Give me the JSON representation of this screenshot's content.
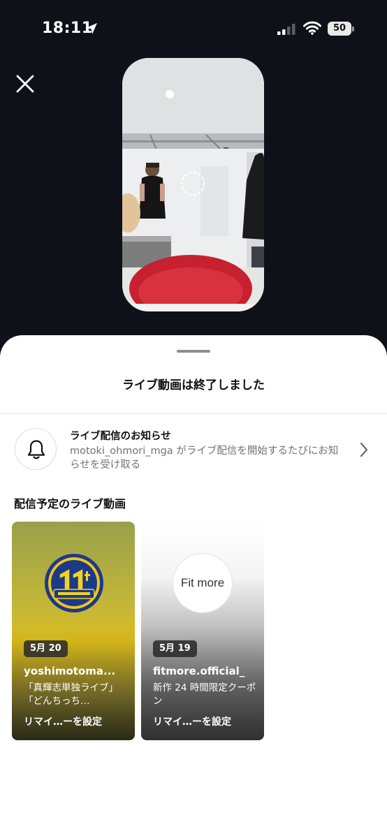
{
  "status_bar": {
    "time": "18:11",
    "battery": "50",
    "icons": [
      "location-arrow-icon",
      "cellular-signal-icon",
      "wifi-icon",
      "battery-icon"
    ]
  },
  "close_icon": "close-icon",
  "sheet": {
    "title": "ライブ動画は終了しました",
    "notification": {
      "title": "ライブ配信のお知らせ",
      "description": "motoki_ohmori_mga がライブ配信を開始するたびにお知らせを受け取る",
      "icon": "bell-icon"
    },
    "scheduled_title": "配信予定のライブ動画",
    "cards": [
      {
        "date": "5月 20",
        "username": "yoshimotoma...",
        "description": "「真輝志単独ライブ」「どんちっち…",
        "reminder": "リマイ…ーを設定"
      },
      {
        "date": "5月 19",
        "username": "fitmore.official_",
        "description": "新作 24 時間限定クーポン",
        "reminder": "リマイ…ーを設定",
        "logo_text": "Fit more"
      }
    ]
  },
  "colors": {
    "background": "#0e1218",
    "sheet": "#ffffff",
    "secondary_text": "#737373"
  }
}
